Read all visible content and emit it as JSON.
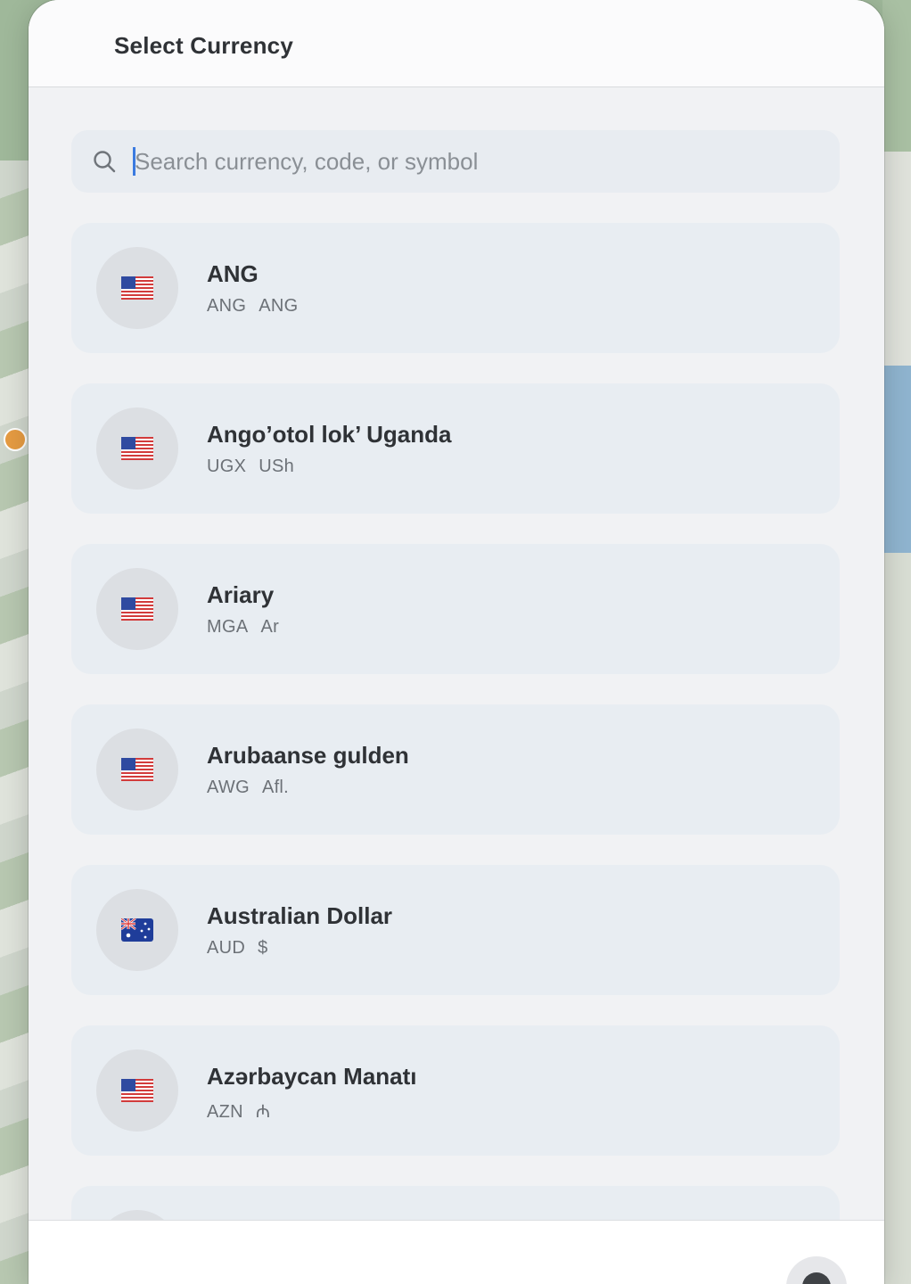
{
  "sheet": {
    "title": "Select Currency"
  },
  "search": {
    "placeholder": "Search currency, code, or symbol",
    "value": ""
  },
  "currencies": [
    {
      "name": "ANG",
      "code": "ANG",
      "symbol": "ANG",
      "flag": "us-flag"
    },
    {
      "name": "Ango’otol lok’ Uganda",
      "code": "UGX",
      "symbol": "USh",
      "flag": "us-flag"
    },
    {
      "name": "Ariary",
      "code": "MGA",
      "symbol": "Ar",
      "flag": "us-flag"
    },
    {
      "name": "Arubaanse gulden",
      "code": "AWG",
      "symbol": "Afl.",
      "flag": "us-flag"
    },
    {
      "name": "Australian Dollar",
      "code": "AUD",
      "symbol": "$",
      "flag": "au-flag"
    },
    {
      "name": "Azərbaycan Manatı",
      "code": "AZN",
      "symbol": "₼",
      "flag": "us-flag"
    }
  ],
  "colors": {
    "accent": "#3b7ae0",
    "sheet_bg": "#f1f2f4",
    "row_bg": "#e8edf2"
  }
}
